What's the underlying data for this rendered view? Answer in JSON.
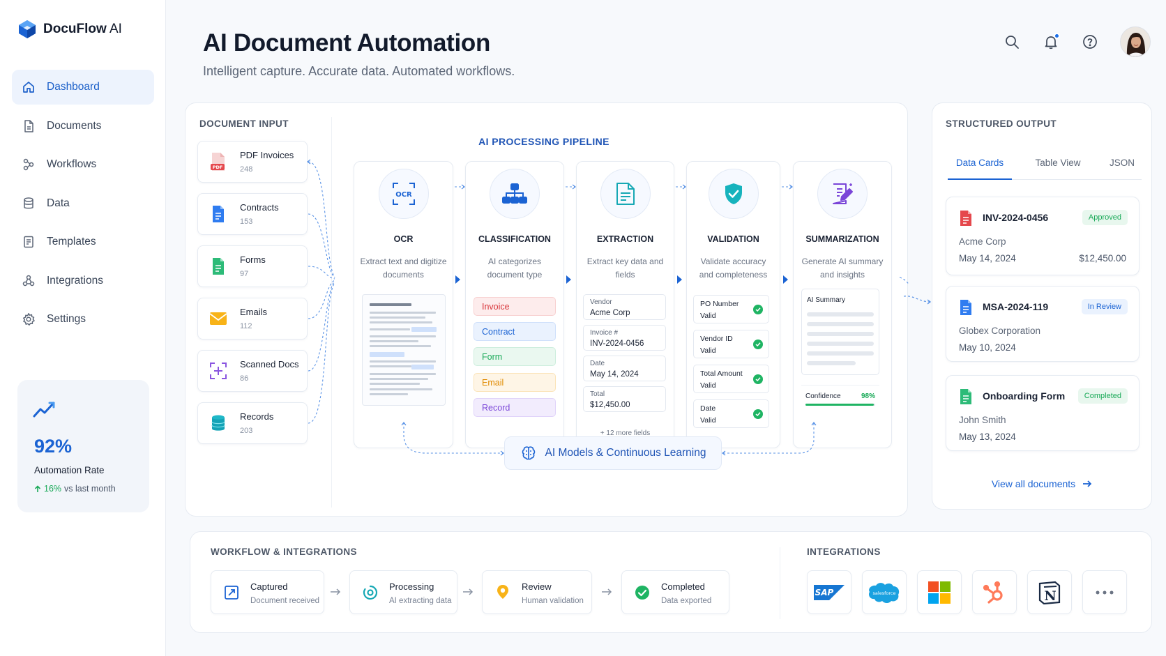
{
  "brand": {
    "name_bold": "DocuFlow",
    "name_light": " AI"
  },
  "sidebar": {
    "items": [
      {
        "label": "Dashboard",
        "icon": "home-icon",
        "active": true
      },
      {
        "label": "Documents",
        "icon": "document-icon",
        "active": false
      },
      {
        "label": "Workflows",
        "icon": "workflow-icon",
        "active": false
      },
      {
        "label": "Data",
        "icon": "database-icon",
        "active": false
      },
      {
        "label": "Templates",
        "icon": "template-icon",
        "active": false
      },
      {
        "label": "Integrations",
        "icon": "integrations-icon",
        "active": false
      },
      {
        "label": "Settings",
        "icon": "gear-icon",
        "active": false
      }
    ],
    "rate_card": {
      "value": "92%",
      "label": "Automation Rate",
      "trend_value": "16%",
      "trend_text": " vs last month"
    }
  },
  "header": {
    "title": "AI Document Automation",
    "subtitle": "Intelligent capture. Accurate data. Automated workflows."
  },
  "input": {
    "title": "DOCUMENT INPUT",
    "items": [
      {
        "name": "PDF Invoices",
        "count": "248",
        "icon": "pdf-icon"
      },
      {
        "name": "Contracts",
        "count": "153",
        "icon": "contract-icon"
      },
      {
        "name": "Forms",
        "count": "97",
        "icon": "form-icon"
      },
      {
        "name": "Emails",
        "count": "112",
        "icon": "email-icon"
      },
      {
        "name": "Scanned Docs",
        "count": "86",
        "icon": "scan-icon"
      },
      {
        "name": "Records",
        "count": "203",
        "icon": "records-icon"
      }
    ]
  },
  "pipeline": {
    "title": "AI PROCESSING PIPELINE",
    "stages": [
      {
        "name": "OCR",
        "desc": "Extract text and digitize documents",
        "icon_text": "OCR"
      },
      {
        "name": "CLASSIFICATION",
        "desc": "AI categorizes document type"
      },
      {
        "name": "EXTRACTION",
        "desc": "Extract key data and fields"
      },
      {
        "name": "VALIDATION",
        "desc": "Validate accuracy and completeness"
      },
      {
        "name": "SUMMARIZATION",
        "desc": "Generate AI summary and insights"
      }
    ],
    "classification_chips": [
      "Invoice",
      "Contract",
      "Form",
      "Email",
      "Record"
    ],
    "extraction_fields": [
      {
        "key": "Vendor",
        "value": "Acme Corp"
      },
      {
        "key": "Invoice #",
        "value": "INV-2024-0456"
      },
      {
        "key": "Date",
        "value": "May 14, 2024"
      },
      {
        "key": "Total",
        "value": "$12,450.00"
      }
    ],
    "more_fields": "+ 12 more fields",
    "validation_items": [
      {
        "key": "PO Number",
        "value": "Valid"
      },
      {
        "key": "Vendor ID",
        "value": "Valid"
      },
      {
        "key": "Total Amount",
        "value": "Valid"
      },
      {
        "key": "Date",
        "value": "Valid"
      }
    ],
    "summary_label": "AI Summary",
    "confidence_label": "Confidence",
    "confidence_value": "98%",
    "confidence_fraction": 0.98,
    "learning_label": "AI Models & Continuous Learning"
  },
  "output": {
    "title": "STRUCTURED OUTPUT",
    "tabs": [
      "Data Cards",
      "Table View",
      "JSON"
    ],
    "cards": [
      {
        "id": "INV-2024-0456",
        "status": "Approved",
        "party": "Acme Corp",
        "date": "May 14, 2024",
        "amount": "$12,450.00"
      },
      {
        "id": "MSA-2024-119",
        "status": "In Review",
        "party": "Globex Corporation",
        "date": "May 10, 2024"
      },
      {
        "id": "Onboarding Form",
        "status": "Completed",
        "party": "John Smith",
        "date": "May 13, 2024"
      }
    ],
    "view_all": "View all documents"
  },
  "workflow": {
    "title": "WORKFLOW & INTEGRATIONS",
    "steps": [
      {
        "title": "Captured",
        "sub": "Document received"
      },
      {
        "title": "Processing",
        "sub": "AI extracting data"
      },
      {
        "title": "Review",
        "sub": "Human validation"
      },
      {
        "title": "Completed",
        "sub": "Data exported"
      }
    ]
  },
  "integrations": {
    "title": "INTEGRATIONS",
    "items": [
      "SAP",
      "salesforce",
      "Microsoft",
      "HubSpot",
      "Notion",
      "More"
    ],
    "sap_label": "SAP",
    "salesforce_label": "salesforce",
    "notion_label": "N"
  },
  "colors": {
    "accent": "#1b63d3",
    "success": "#1fb463",
    "review": "#1b63d3",
    "danger": "#e5484d"
  }
}
